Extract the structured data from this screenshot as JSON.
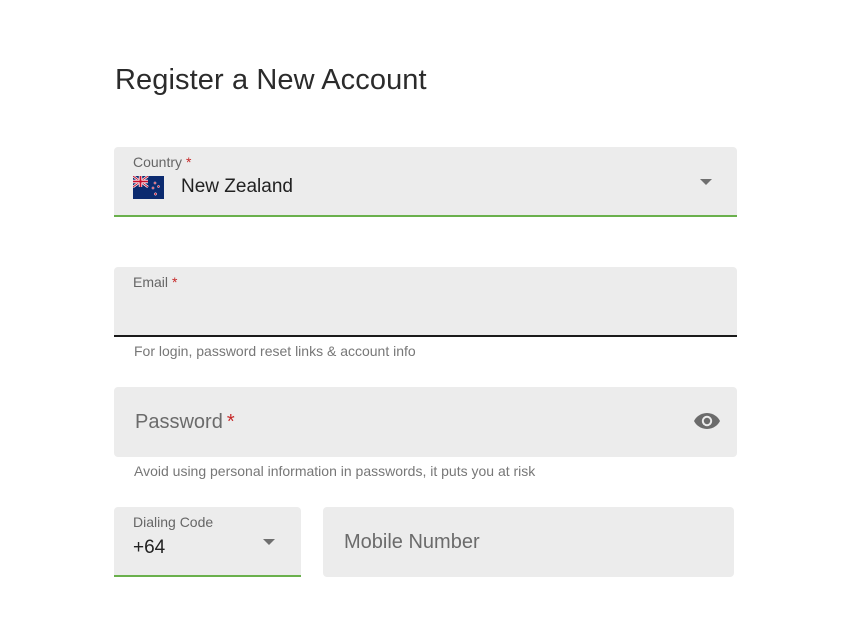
{
  "page": {
    "title": "Register a New Account"
  },
  "country": {
    "label": "Country",
    "required_mark": "*",
    "value": "New Zealand",
    "flag_icon": "new-zealand-flag-icon"
  },
  "email": {
    "label": "Email",
    "required_mark": "*",
    "value": "",
    "helper": "For login, password reset links & account info"
  },
  "password": {
    "label": "Password",
    "required_mark": "*",
    "value": "",
    "visibility_icon": "eye-icon",
    "helper": "Avoid using personal information in passwords, it puts you at risk"
  },
  "dialing_code": {
    "label": "Dialing Code",
    "value": "+64"
  },
  "mobile": {
    "label": "Mobile Number",
    "value": ""
  },
  "colors": {
    "accent_green": "#6ab04c",
    "field_bg": "#ececec",
    "required_red": "#c62828"
  }
}
